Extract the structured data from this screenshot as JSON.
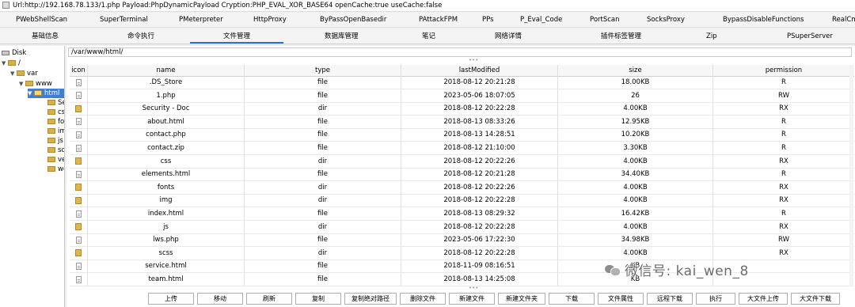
{
  "window": {
    "title": "Url:http://192.168.78.133/1.php Payload:PhpDynamicPayload Cryption:PHP_EVAL_XOR_BASE64 openCache:true useCache:false"
  },
  "plugin_tabs": [
    "PWebShellScan",
    "SuperTerminal",
    "PMeterpreter",
    "HttpProxy",
    "ByPassOpenBasedir",
    "PAttackFPM",
    "PPs",
    "P_Eval_Code",
    "PortScan",
    "SocksProxy",
    "BypassDisableFunctions",
    "RealCm"
  ],
  "function_tabs": [
    "基础信息",
    "命令执行",
    "文件管理",
    "数据库管理",
    "笔记",
    "网络详情",
    "插件标签管理",
    "Zip",
    "PSuperServer"
  ],
  "active_function_tab": "文件管理",
  "tree": {
    "disk": "Disk",
    "root": "/",
    "var": "var",
    "www": "www",
    "html": "html",
    "children": [
      "Se",
      "cs",
      "fo",
      "im",
      "js",
      "sc",
      "ve",
      "wo"
    ]
  },
  "path": "/var/www/html/",
  "table": {
    "columns": [
      "icon",
      "name",
      "type",
      "lastModified",
      "size",
      "permission"
    ],
    "rows": [
      {
        "icon": "file-icon",
        "name": ".DS_Store",
        "type": "file",
        "lastModified": "2018-08-12 20:21:28",
        "size": "18.00KB",
        "permission": "R"
      },
      {
        "icon": "file-icon",
        "name": "1.php",
        "type": "file",
        "lastModified": "2023-05-06 18:07:05",
        "size": "26",
        "permission": "RW"
      },
      {
        "icon": "folder-icon",
        "name": "Security - Doc",
        "type": "dir",
        "lastModified": "2018-08-12 20:22:28",
        "size": "4.00KB",
        "permission": "RX"
      },
      {
        "icon": "file-icon",
        "name": "about.html",
        "type": "file",
        "lastModified": "2018-08-13 08:33:26",
        "size": "12.95KB",
        "permission": "R"
      },
      {
        "icon": "file-icon",
        "name": "contact.php",
        "type": "file",
        "lastModified": "2018-08-13 14:28:51",
        "size": "10.20KB",
        "permission": "R"
      },
      {
        "icon": "file-icon",
        "name": "contact.zip",
        "type": "file",
        "lastModified": "2018-08-12 21:10:00",
        "size": "3.30KB",
        "permission": "R"
      },
      {
        "icon": "folder-icon",
        "name": "css",
        "type": "dir",
        "lastModified": "2018-08-12 20:22:26",
        "size": "4.00KB",
        "permission": "RX"
      },
      {
        "icon": "file-icon",
        "name": "elements.html",
        "type": "file",
        "lastModified": "2018-08-12 20:21:28",
        "size": "34.40KB",
        "permission": "R"
      },
      {
        "icon": "folder-icon",
        "name": "fonts",
        "type": "dir",
        "lastModified": "2018-08-12 20:22:26",
        "size": "4.00KB",
        "permission": "RX"
      },
      {
        "icon": "folder-icon",
        "name": "img",
        "type": "dir",
        "lastModified": "2018-08-12 20:22:28",
        "size": "4.00KB",
        "permission": "RX"
      },
      {
        "icon": "file-icon",
        "name": "index.html",
        "type": "file",
        "lastModified": "2018-08-13 08:29:32",
        "size": "16.42KB",
        "permission": "R"
      },
      {
        "icon": "folder-icon",
        "name": "js",
        "type": "dir",
        "lastModified": "2018-08-12 20:22:28",
        "size": "4.00KB",
        "permission": "RX"
      },
      {
        "icon": "file-icon",
        "name": "lws.php",
        "type": "file",
        "lastModified": "2023-05-06 17:22:30",
        "size": "34.98KB",
        "permission": "RW"
      },
      {
        "icon": "folder-icon",
        "name": "scss",
        "type": "dir",
        "lastModified": "2018-08-12 20:22:28",
        "size": "4.00KB",
        "permission": "RX"
      },
      {
        "icon": "file-icon",
        "name": "service.html",
        "type": "file",
        "lastModified": "2018-11-09 08:16:51",
        "size": "KB",
        "permission": ""
      },
      {
        "icon": "file-icon",
        "name": "team.html",
        "type": "file",
        "lastModified": "2018-08-13 14:25:08",
        "size": "KB",
        "permission": ""
      }
    ]
  },
  "buttons": [
    "上传",
    "移动",
    "刷新",
    "复制",
    "复制绝对路径",
    "删除文件",
    "新建文件",
    "新建文件夹",
    "下载",
    "文件属性",
    "远程下载",
    "执行",
    "大文件上传",
    "大文件下载"
  ],
  "watermark": "微信号: kai_wen_8"
}
